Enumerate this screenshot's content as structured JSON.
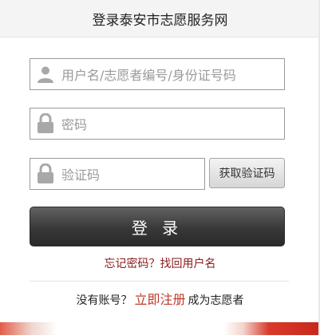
{
  "header": {
    "title": "登录泰安市志愿服务网"
  },
  "form": {
    "username_placeholder": "用户名/志愿者编号/身份证号码",
    "password_placeholder": "密码",
    "captcha_placeholder": "验证码",
    "get_code_label": "获取验证码",
    "login_label": "登 录"
  },
  "links": {
    "forgot": "忘记密码？找回用户名",
    "no_account": "没有账号？",
    "register": "立即注册",
    "become": "成为志愿者"
  },
  "icons": {
    "user": "user-icon",
    "lock": "lock-icon"
  },
  "colors": {
    "link_red": "#c0392b",
    "forgot_red": "#8b1a1a",
    "button_dark": "#383838"
  }
}
